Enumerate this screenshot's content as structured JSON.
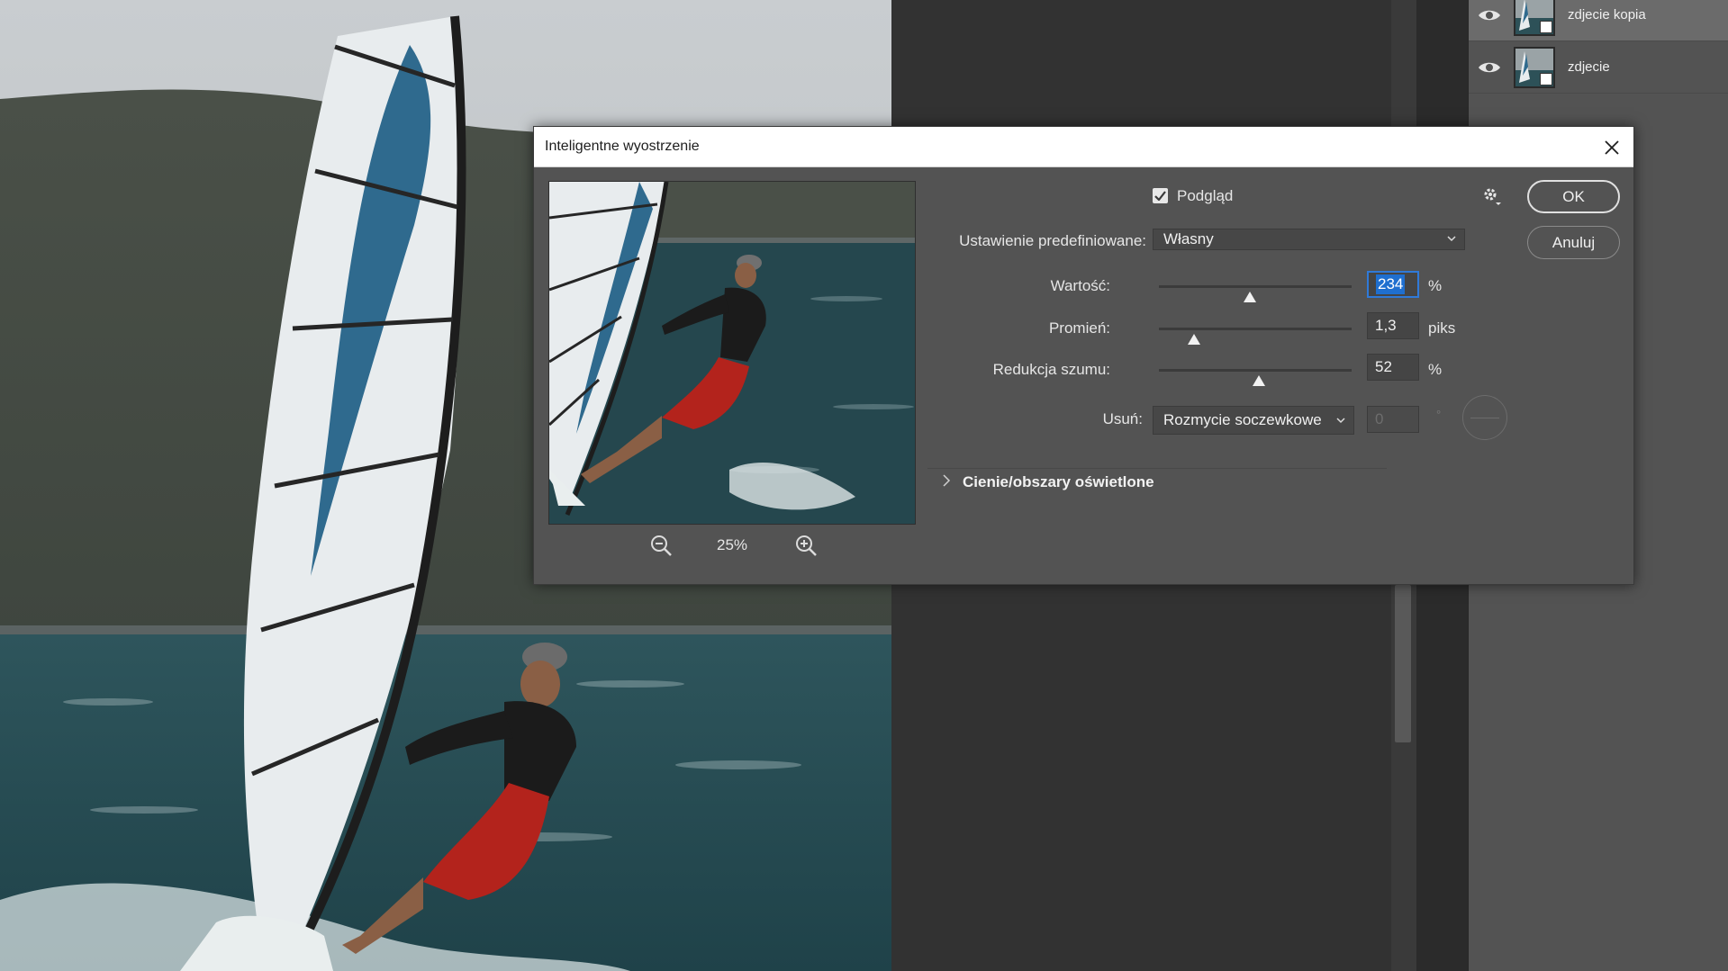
{
  "dialog": {
    "title": "Inteligentne wyostrzenie",
    "zoom": "25%",
    "preview_label": "Podgląd",
    "preview_checked": true,
    "preset_label": "Ustawienie predefiniowane:",
    "preset_value": "Własny",
    "amount_label": "Wartość:",
    "amount_value": "234",
    "amount_unit": "%",
    "amount_level": 0.47,
    "radius_label": "Promień:",
    "radius_value": "1,3",
    "radius_unit": "piks",
    "radius_level": 0.18,
    "noise_label": "Redukcja szumu:",
    "noise_value": "52",
    "noise_unit": "%",
    "noise_level": 0.52,
    "remove_label": "Usuń:",
    "remove_value": "Rozmycie soczewkowe",
    "angle_value": "0",
    "angle_unit": "°",
    "ok_label": "OK",
    "cancel_label": "Anuluj",
    "section_label": "Cienie/obszary oświetlone"
  },
  "layers": [
    {
      "name": "zdjecie kopia",
      "selected": true,
      "visible": true
    },
    {
      "name": "zdjecie",
      "selected": false,
      "visible": true
    }
  ],
  "icons": [
    "eye-icon",
    "close-icon",
    "gear-icon",
    "zoom-out-icon",
    "zoom-in-icon",
    "chevron-right-icon",
    "chevron-down-icon",
    "checkbox-check-icon"
  ],
  "colors": {
    "dialog_bg": "#535353",
    "canvas_bg": "#323232",
    "focus_blue": "#1f6fcf",
    "sail_blue": "#2f6a8e",
    "shorts_red": "#b3231c",
    "water": "#24464d"
  }
}
